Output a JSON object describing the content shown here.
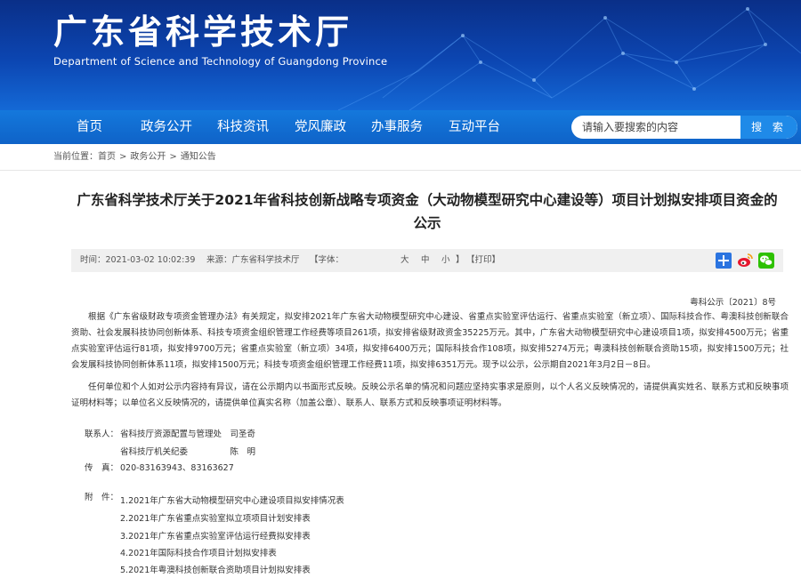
{
  "header": {
    "site_title": "广东省科学技术厅",
    "site_subtitle": "Department of Science and Technology of Guangdong Province"
  },
  "nav": {
    "items": [
      "首页",
      "政务公开",
      "科技资讯",
      "党风廉政",
      "办事服务",
      "互动平台"
    ]
  },
  "search": {
    "placeholder": "请输入要搜索的内容",
    "button_label": "搜 索"
  },
  "breadcrumb": {
    "prefix": "当前位置：",
    "items": [
      "首页",
      "政务公开",
      "通知公告"
    ]
  },
  "article": {
    "title": "广东省科学技术厅关于2021年省科技创新战略专项资金（大动物模型研究中心建设等）项目计划拟安排项目资金的公示",
    "meta": {
      "time": "时间：2021-03-02 10:02:39",
      "source": "来源：广东省科学技术厅",
      "font_label": "【字体：",
      "font_large": "大",
      "font_medium": "中",
      "font_small": "小",
      "font_end": "】",
      "print": "【打印】"
    },
    "share_icons": [
      "plus-share-icon",
      "weibo-icon",
      "wechat-icon"
    ],
    "doc_number": "粤科公示〔2021〕8号",
    "paragraph1": "根据《广东省级财政专项资金管理办法》有关规定，拟安排2021年广东省大动物模型研究中心建设、省重点实验室评估运行、省重点实验室（新立项）、国际科技合作、粤澳科技创新联合资助、社会发展科技协同创新体系、科技专项资金组织管理工作经费等项目261项，拟安排省级财政资金35225万元。其中，广东省大动物模型研究中心建设项目1项，拟安排4500万元；省重点实验室评估运行81项，拟安排9700万元；省重点实验室（新立项）34项，拟安排6400万元；国际科技合作108项，拟安排5274万元；粤澳科技创新联合资助15项，拟安排1500万元；社会发展科技协同创新体系11项，拟安排1500万元；科技专项资金组织管理工作经费11项，拟安排6351万元。现予以公示，公示期自2021年3月2日－8日。",
    "paragraph2": "任何单位和个人如对公示内容持有异议，请在公示期内以书面形式反映。反映公示名单的情况和问题应坚持实事求是原则，以个人名义反映情况的，请提供真实姓名、联系方式和反映事项证明材料等；以单位名义反映情况的，请提供单位真实名称（加盖公章）、联系人、联系方式和反映事项证明材料等。",
    "contact": {
      "label": "联系人：",
      "line1": "省科技厅资源配置与管理处　司圣奇",
      "line2": "省科技厅机关纪委　　　　　陈　明",
      "fax_label": "传　真：",
      "fax": "020-83163943、83163627"
    },
    "attachments": {
      "label": "附　件：",
      "items": [
        "1.2021年广东省大动物模型研究中心建设项目拟安排情况表",
        "2.2021年广东省重点实验室拟立项项目计划安排表",
        "3.2021年广东省重点实验室评估运行经费拟安排表",
        "4.2021年国际科技合作项目计划拟安排表",
        "5.2021年粤澳科技创新联合资助项目计划拟安排表"
      ]
    }
  },
  "colors": {
    "banner_dark": "#0a2f88",
    "banner_light": "#1469d6",
    "nav_bg": "#1478dc",
    "search_button": "#1f8ae8",
    "meta_bg": "#f0f0f0"
  }
}
